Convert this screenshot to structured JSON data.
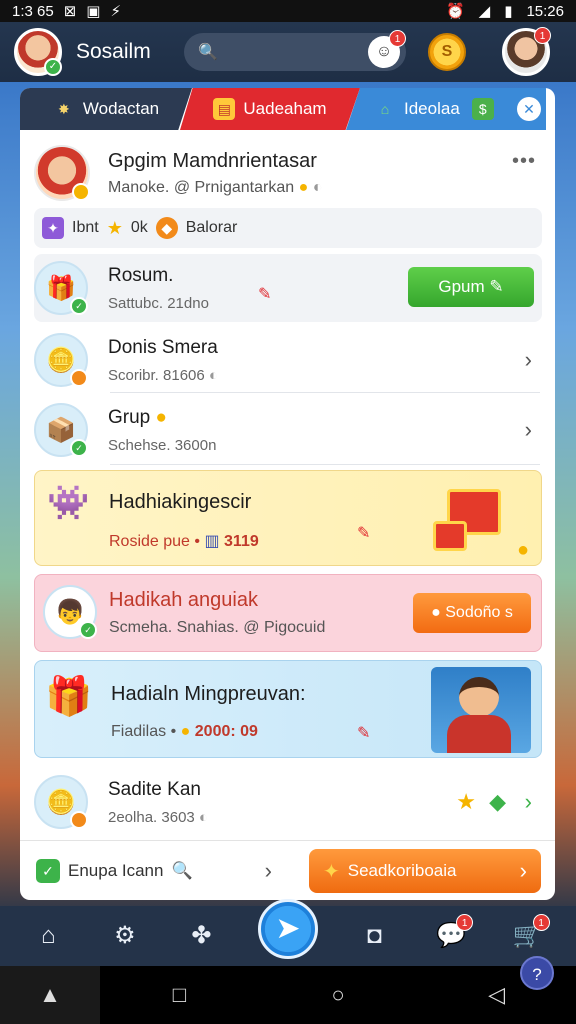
{
  "status_bar": {
    "time_left": "1:3 65",
    "time_right": "15:26"
  },
  "app": {
    "title": "Sosailm"
  },
  "header": {
    "notification_count": "1",
    "coin_symbol": "S",
    "profile_badge": "1"
  },
  "tabs": [
    {
      "label": "Wodactan"
    },
    {
      "label": "Uadeaham"
    },
    {
      "label": "Ideolaa"
    }
  ],
  "profile": {
    "name": "Gpgim Mamdnrientasar",
    "subtitle": "Manoke. @ Prnigantarkan",
    "more": "•••"
  },
  "stats": {
    "label1": "Ibnt",
    "value": "0k",
    "label2": "Balorar"
  },
  "rows": [
    {
      "title": "Rosum.",
      "subtitle": "Sattubc. 21dno",
      "button": "Gpum"
    },
    {
      "title": "Donis Smera",
      "subtitle": "Scoribr. 81606"
    },
    {
      "title": "Grup",
      "subtitle": "Schehse. 3600n"
    }
  ],
  "highlights": [
    {
      "title": "Hadhiakingescir",
      "subtitle": "Roside pue •",
      "value": "3119"
    },
    {
      "title": "Hadikah anguiak",
      "subtitle": "Scmeha. Snahias. @ Pigocuid",
      "button": "Sodoño s"
    },
    {
      "title": "Hadialn Mingpreuvan:",
      "subtitle": "Fiadilas •",
      "value": "2000: 09"
    }
  ],
  "last_row": {
    "title": "Sadite Kan",
    "subtitle": "2eolha. 3603"
  },
  "footer": {
    "search_label": "Enupa Icann",
    "action_label": "Seadkoriboaia"
  },
  "nav": {
    "chat_badge": "1",
    "cart_badge": "1",
    "help": "?"
  },
  "colors": {
    "accent_green": "#35a62d",
    "accent_orange": "#f26b12",
    "accent_red": "#e0292f",
    "accent_blue": "#3a8ad8"
  }
}
